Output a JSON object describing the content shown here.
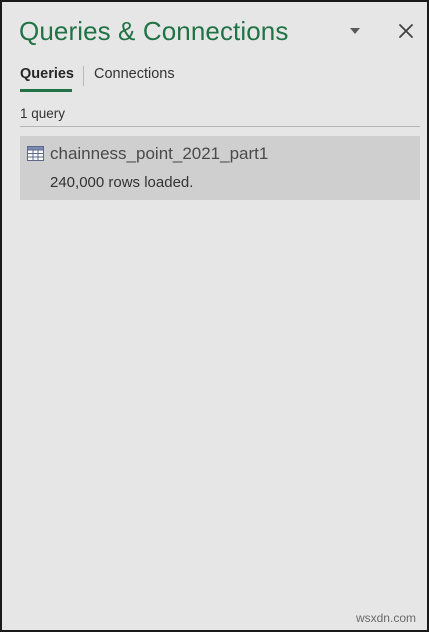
{
  "pane": {
    "title": "Queries & Connections",
    "menu_icon": "chevron-down-icon",
    "close_icon": "close-icon"
  },
  "tabs": [
    {
      "label": "Queries",
      "active": true
    },
    {
      "label": "Connections",
      "active": false
    }
  ],
  "query_count": "1 query",
  "queries": [
    {
      "icon": "table-icon",
      "name": "chainness_point_2021_part1",
      "status": "240,000 rows loaded."
    }
  ],
  "watermark": "wsxdn.com",
  "colors": {
    "accent": "#217346",
    "background": "#e6e6e6",
    "selected_item": "#cfcfcf"
  }
}
